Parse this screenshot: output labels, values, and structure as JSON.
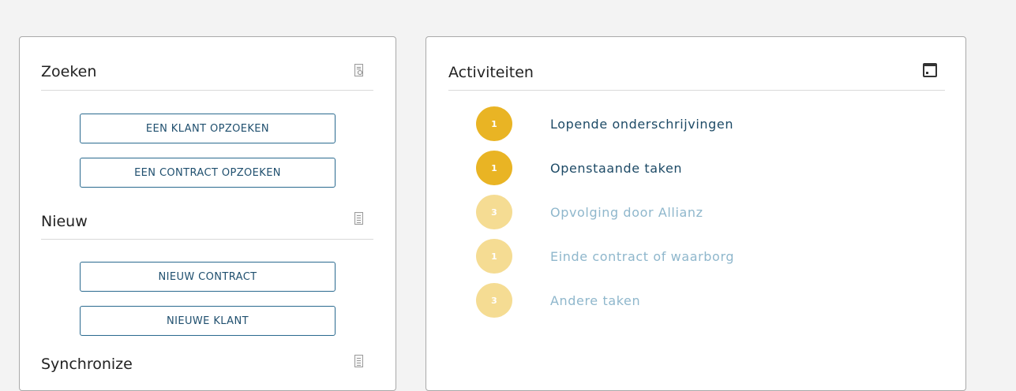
{
  "left_panel": {
    "search": {
      "title": "Zoeken",
      "icon": "search-document-icon",
      "buttons": [
        "EEN KLANT OPZOEKEN",
        "EEN CONTRACT OPZOEKEN"
      ]
    },
    "new": {
      "title": "Nieuw",
      "icon": "document-icon",
      "buttons": [
        "NIEUW CONTRACT",
        "NIEUWE KLANT"
      ]
    },
    "sync": {
      "title": "Synchronize",
      "icon": "document-icon"
    }
  },
  "activities": {
    "title": "Activiteiten",
    "icon": "calendar-icon",
    "items": [
      {
        "count": "1",
        "label": "Lopende onderschrijvingen",
        "active": true
      },
      {
        "count": "1",
        "label": "Openstaande taken",
        "active": true
      },
      {
        "count": "3",
        "label": "Opvolging door Allianz",
        "active": false
      },
      {
        "count": "1",
        "label": "Einde contract of waarborg",
        "active": false
      },
      {
        "count": "3",
        "label": "Andere taken",
        "active": false
      }
    ]
  },
  "colors": {
    "badge_active": "#e9b424",
    "badge_inactive": "#f5dc93",
    "label_active": "#1d4a66",
    "label_inactive": "#8fb7cc",
    "button_border": "#2a6a8f"
  }
}
